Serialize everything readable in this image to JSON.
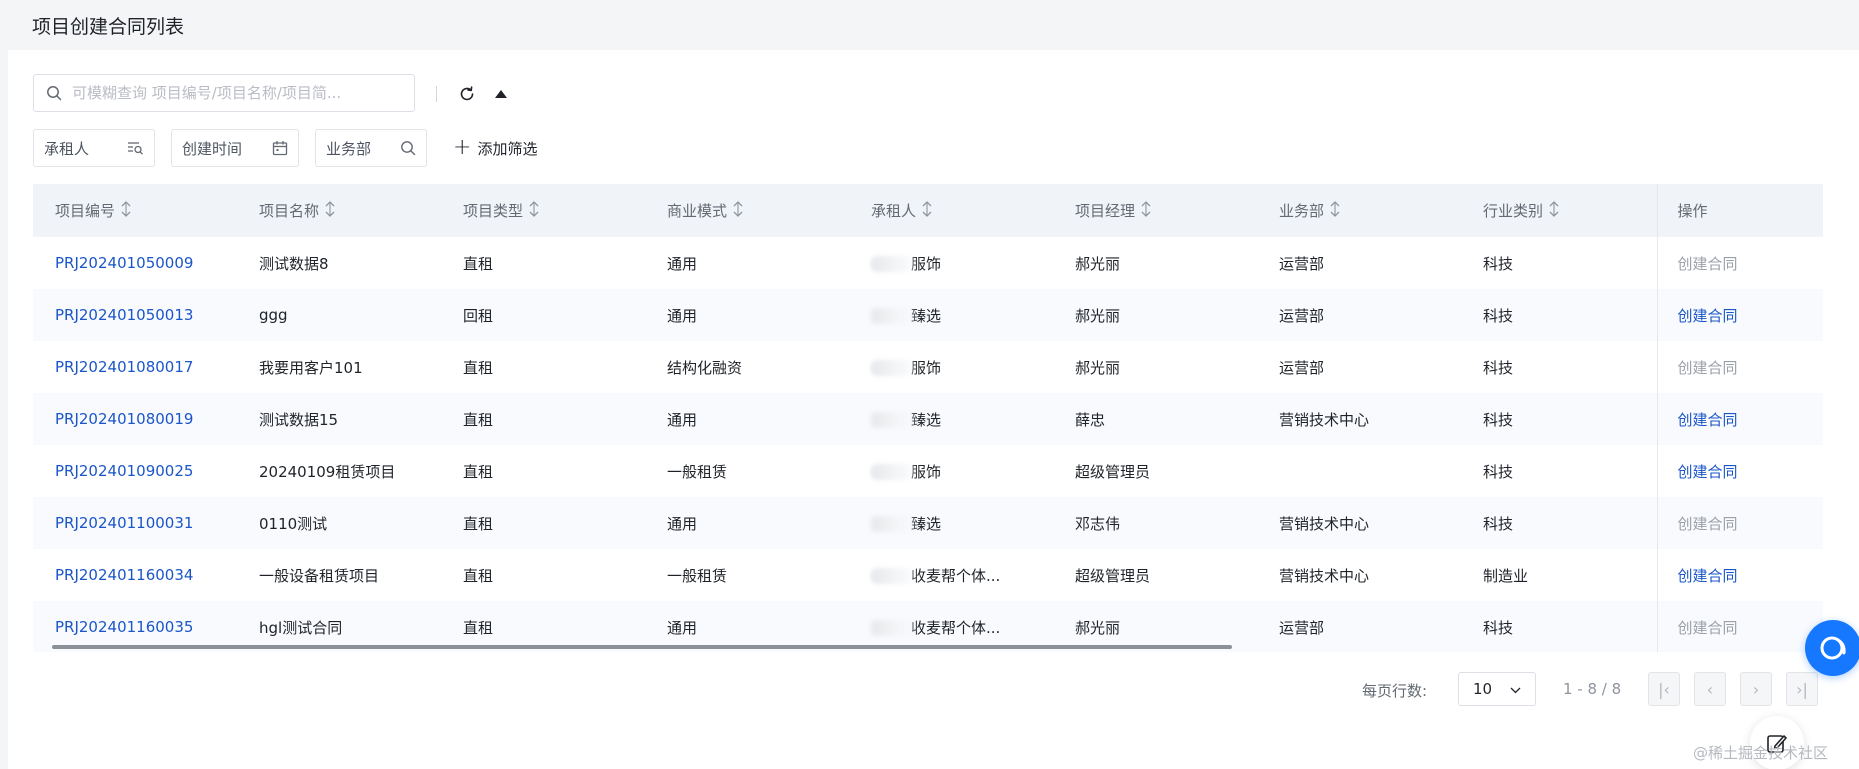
{
  "page": {
    "title": "项目创建合同列表"
  },
  "toolbar": {
    "search_placeholder": "可模糊查询 项目编号/项目名称/项目简...",
    "filters": [
      {
        "label": "承租人",
        "icon": "search-list-icon"
      },
      {
        "label": "创建时间",
        "icon": "calendar-icon"
      },
      {
        "label": "业务部",
        "icon": "search-icon"
      }
    ],
    "add_filter_label": "添加筛选"
  },
  "table": {
    "columns": [
      "项目编号",
      "项目名称",
      "项目类型",
      "商业模式",
      "承租人",
      "项目经理",
      "业务部",
      "行业类别",
      "操作"
    ],
    "rows": [
      {
        "code": "PRJ202401050009",
        "name": "测试数据8",
        "type": "直租",
        "mode": "通用",
        "lessee": "服饰",
        "manager": "郝光丽",
        "dept": "运营部",
        "industry": "科技",
        "action": "创建合同",
        "action_enabled": false
      },
      {
        "code": "PRJ202401050013",
        "name": "ggg",
        "type": "回租",
        "mode": "通用",
        "lessee": "臻选",
        "manager": "郝光丽",
        "dept": "运营部",
        "industry": "科技",
        "action": "创建合同",
        "action_enabled": true
      },
      {
        "code": "PRJ202401080017",
        "name": "我要用客户101",
        "type": "直租",
        "mode": "结构化融资",
        "lessee": "服饰",
        "manager": "郝光丽",
        "dept": "运营部",
        "industry": "科技",
        "action": "创建合同",
        "action_enabled": false
      },
      {
        "code": "PRJ202401080019",
        "name": "测试数据15",
        "type": "直租",
        "mode": "通用",
        "lessee": "臻选",
        "manager": "薛忠",
        "dept": "营销技术中心",
        "industry": "科技",
        "action": "创建合同",
        "action_enabled": true
      },
      {
        "code": "PRJ202401090025",
        "name": "20240109租赁项目",
        "type": "直租",
        "mode": "一般租赁",
        "lessee": "服饰",
        "manager": "超级管理员",
        "dept": "",
        "industry": "科技",
        "action": "创建合同",
        "action_enabled": true
      },
      {
        "code": "PRJ202401100031",
        "name": "0110测试",
        "type": "直租",
        "mode": "通用",
        "lessee": "臻选",
        "manager": "邓志伟",
        "dept": "营销技术中心",
        "industry": "科技",
        "action": "创建合同",
        "action_enabled": false
      },
      {
        "code": "PRJ202401160034",
        "name": "一般设备租赁项目",
        "type": "直租",
        "mode": "一般租赁",
        "lessee": "收麦帮个体...",
        "manager": "超级管理员",
        "dept": "营销技术中心",
        "industry": "制造业",
        "action": "创建合同",
        "action_enabled": true
      },
      {
        "code": "PRJ202401160035",
        "name": "hgl测试合同",
        "type": "直租",
        "mode": "通用",
        "lessee": "收麦帮个体...",
        "manager": "郝光丽",
        "dept": "运营部",
        "industry": "科技",
        "action": "创建合同",
        "action_enabled": false
      }
    ]
  },
  "pagination": {
    "rows_per_page_label": "每页行数:",
    "page_size": "10",
    "range": "1 - 8 / 8"
  },
  "watermark": "@稀土掘金技术社区",
  "colors": {
    "link": "#1a56c8",
    "header_bg": "#f0f3f8",
    "fab": "#1677ff"
  }
}
